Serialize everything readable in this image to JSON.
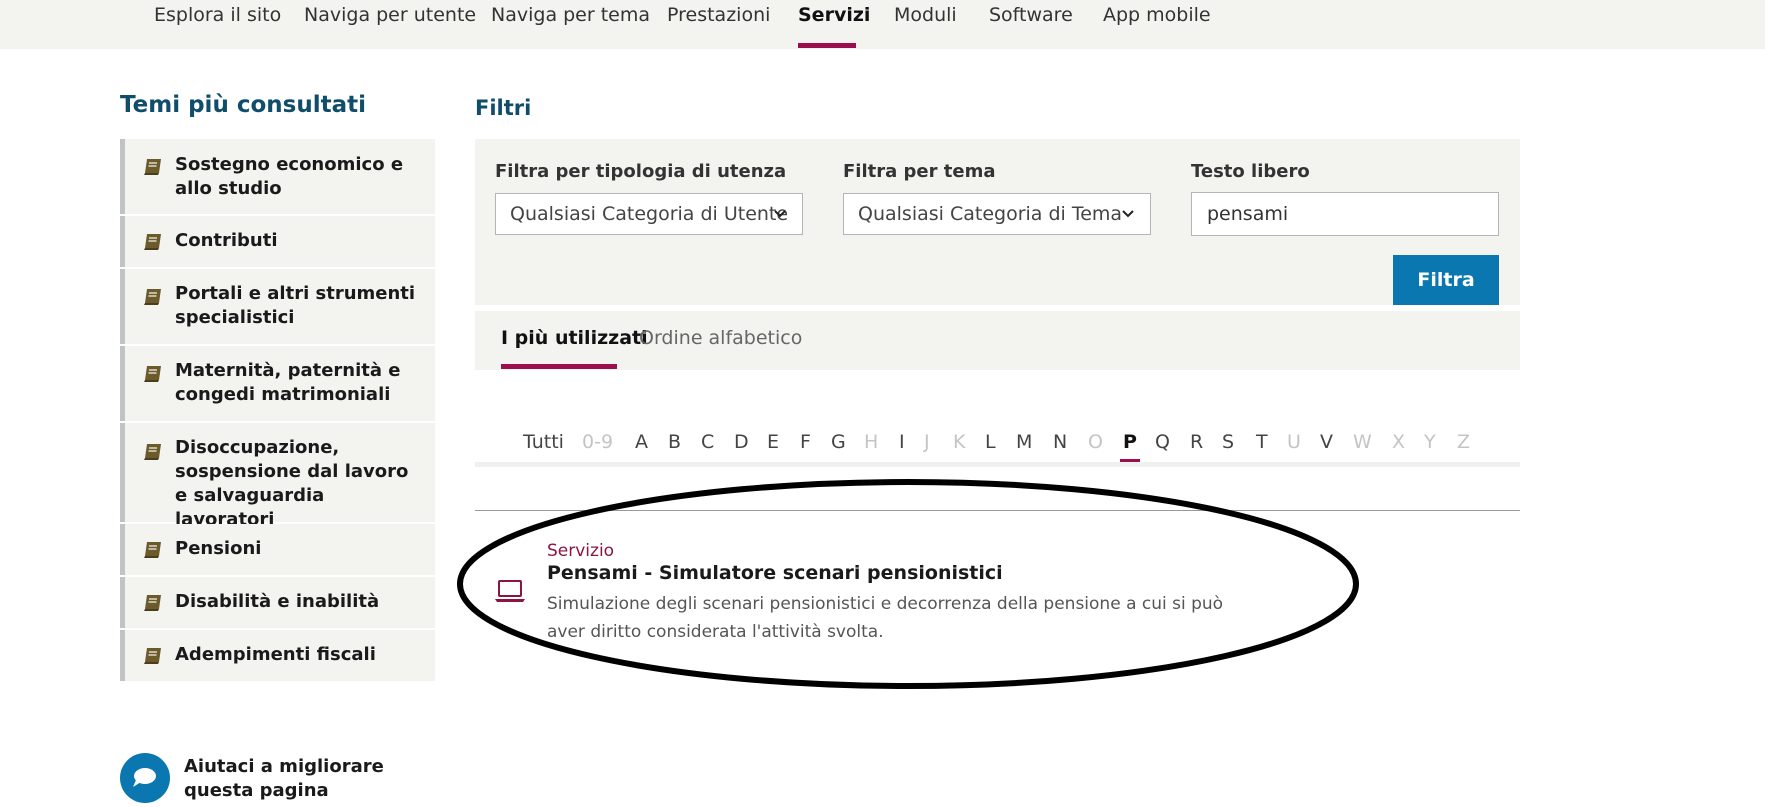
{
  "topnav": {
    "items": [
      "Esplora il sito",
      "Naviga per utente",
      "Naviga per tema",
      "Prestazioni",
      "Servizi",
      "Moduli",
      "Software",
      "App mobile"
    ],
    "active": "Servizi"
  },
  "sidebar": {
    "title": "Temi più consultati",
    "items": [
      "Sostegno economico e allo studio",
      "Contributi",
      "Portali e altri strumenti specialistici",
      "Maternità, paternità e congedi matrimoniali",
      "Disoccupazione, sospensione dal lavoro e salvaguardia lavoratori",
      "Pensioni",
      "Disabilità e inabilità",
      "Adempimenti fiscali"
    ],
    "icon": "book-icon"
  },
  "filters": {
    "title": "Filtri",
    "user_type": {
      "label": "Filtra per tipologia di utenza",
      "value": "Qualsiasi Categoria di Utente"
    },
    "theme": {
      "label": "Filtra per tema",
      "value": "Qualsiasi Categoria di Tema"
    },
    "free_text": {
      "label": "Testo libero",
      "value": "pensami"
    },
    "button": "Filtra"
  },
  "tabs": {
    "items": [
      "I più utilizzati",
      "Ordine alfabetico"
    ],
    "active": "I più utilizzati"
  },
  "alphabet": {
    "letters": [
      "Tutti",
      "0-9",
      "A",
      "B",
      "C",
      "D",
      "E",
      "F",
      "G",
      "H",
      "I",
      "J",
      "K",
      "L",
      "M",
      "N",
      "O",
      "P",
      "Q",
      "R",
      "S",
      "T",
      "U",
      "V",
      "W",
      "X",
      "Y",
      "Z"
    ],
    "disabled": [
      "0-9",
      "H",
      "J",
      "K",
      "O",
      "U",
      "W",
      "X",
      "Y",
      "Z"
    ],
    "active": "P"
  },
  "result": {
    "category": "Servizio",
    "title": "Pensami - Simulatore scenari pensionistici",
    "description": "Simulazione degli scenari pensionistici e decorrenza della pensione a cui si può aver diritto considerata l'attività svolta.",
    "icon": "laptop-icon"
  },
  "help": {
    "text": "Aiutaci a migliorare questa pagina",
    "icon": "chat-icon"
  },
  "colors": {
    "accent": "#9b0f4e",
    "primary_blue": "#0a77b0",
    "heading_blue": "#0f4d6b",
    "panel_bg": "#f3f3ef",
    "book_icon": "#6b5a2a"
  }
}
